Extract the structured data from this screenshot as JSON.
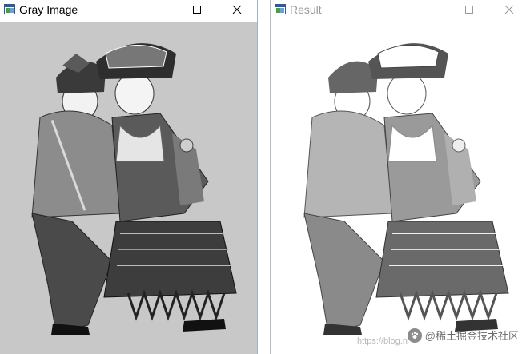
{
  "windows": [
    {
      "title": "Gray Image",
      "active": true,
      "title_color": "#000000",
      "image_description_icon": "grayscale-dancing-couple",
      "image_style": "grayscale"
    },
    {
      "title": "Result",
      "active": false,
      "title_color": "#9a9a9a",
      "image_description_icon": "sketch-dancing-couple",
      "image_style": "high-contrast sketch"
    }
  ],
  "controls": {
    "minimize_icon": "minimize-icon",
    "maximize_icon": "maximize-icon",
    "close_icon": "close-icon"
  },
  "watermark": {
    "url": "https://blog.n",
    "text": "@稀土掘金技术社区"
  },
  "colors": {
    "gray_background": "#c8c8c8",
    "result_background": "#ffffff",
    "active_border": "#9fb3c8"
  }
}
